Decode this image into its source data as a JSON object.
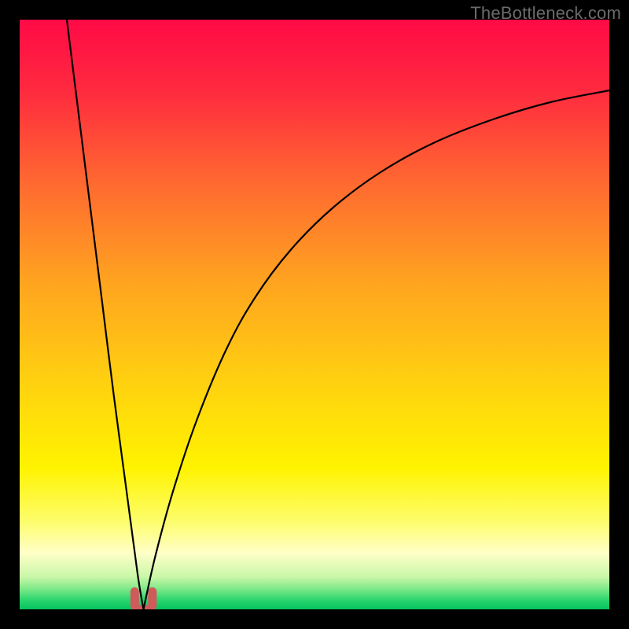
{
  "watermark": "TheBottleneck.com",
  "chart_data": {
    "type": "line",
    "title": "",
    "xlabel": "",
    "ylabel": "",
    "xlim": [
      0,
      100
    ],
    "ylim": [
      0,
      100
    ],
    "grid": false,
    "legend": false,
    "notes": "V-shaped bottleneck curve. y≈100 is worst (red), y≈0 is best (green). The minimum (optimal point) sits near x≈21 where y≈0; a short rounded salmon highlight marks the valley floor.",
    "series": [
      {
        "name": "left-branch",
        "x": [
          8,
          10,
          12,
          14,
          16,
          18,
          20,
          21
        ],
        "values": [
          100,
          84,
          68,
          52,
          36,
          21,
          6,
          0
        ]
      },
      {
        "name": "right-branch",
        "x": [
          21,
          23,
          26,
          30,
          35,
          40,
          46,
          53,
          61,
          70,
          80,
          90,
          100
        ],
        "values": [
          0,
          9,
          20,
          32,
          44,
          53,
          61,
          68,
          74,
          79,
          83,
          86,
          88
        ]
      }
    ],
    "highlight": {
      "name": "valley-marker",
      "color": "#cf5b5b",
      "x_range": [
        19.5,
        22.5
      ],
      "y_range": [
        0,
        3
      ]
    },
    "background_gradient": {
      "type": "vertical",
      "stops": [
        {
          "offset": 0.0,
          "color": "#ff0a46"
        },
        {
          "offset": 0.12,
          "color": "#ff2a3f"
        },
        {
          "offset": 0.28,
          "color": "#ff6a30"
        },
        {
          "offset": 0.45,
          "color": "#ffa51f"
        },
        {
          "offset": 0.62,
          "color": "#ffd20f"
        },
        {
          "offset": 0.76,
          "color": "#fff300"
        },
        {
          "offset": 0.85,
          "color": "#fdfd6b"
        },
        {
          "offset": 0.905,
          "color": "#ffffc8"
        },
        {
          "offset": 0.945,
          "color": "#c9f7a8"
        },
        {
          "offset": 0.965,
          "color": "#7fe98a"
        },
        {
          "offset": 0.985,
          "color": "#27d46d"
        },
        {
          "offset": 1.0,
          "color": "#04c35f"
        }
      ]
    }
  }
}
